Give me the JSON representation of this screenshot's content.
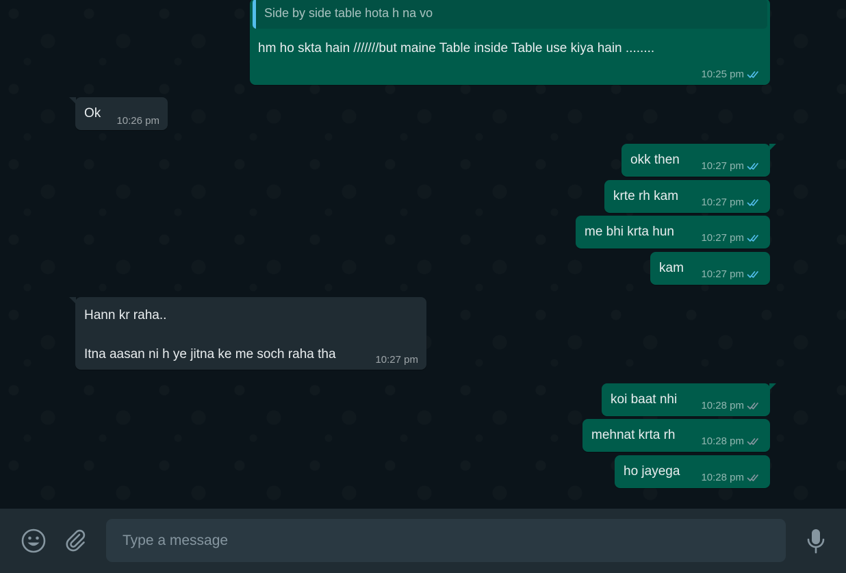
{
  "chat": {
    "quoted": {
      "text": "Side by side table hota h na vo",
      "reply_text": "hm ho skta hain ///////but maine Table inside Table use kiya hain ........",
      "time": "10:25 pm"
    },
    "messages": [
      {
        "text": "Ok",
        "time": "10:26 pm"
      },
      {
        "text": "okk then",
        "time": "10:27 pm"
      },
      {
        "text": "krte rh kam",
        "time": "10:27 pm"
      },
      {
        "text": "me bhi krta hun",
        "time": "10:27 pm"
      },
      {
        "text": "kam",
        "time": "10:27 pm"
      },
      {
        "text": "Hann kr raha..\n\nItna aasan ni h ye jitna ke me soch raha tha",
        "time": "10:27 pm"
      },
      {
        "text": "koi baat nhi",
        "time": "10:28 pm"
      },
      {
        "text": "mehnat krta rh",
        "time": "10:28 pm"
      },
      {
        "text": "ho jayega",
        "time": "10:28 pm"
      }
    ]
  },
  "composer": {
    "placeholder": "Type a message",
    "emoji_icon": "emoji-icon",
    "attach_icon": "paperclip-icon",
    "mic_icon": "mic-icon"
  },
  "colors": {
    "outgoing_bubble": "#005c4b",
    "incoming_bubble": "#202c33",
    "read_ticks": "#53bdeb",
    "delivered_ticks": "#8696a0"
  }
}
